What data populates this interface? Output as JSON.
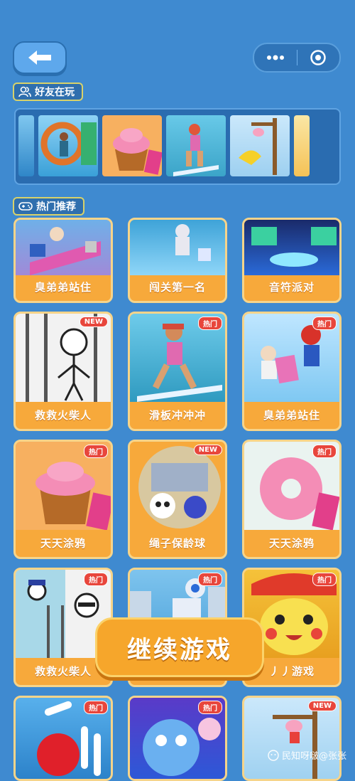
{
  "header": {
    "back_icon": "arrow-left-icon",
    "more_icon": "more-dots-icon",
    "close_icon": "target-circle-icon"
  },
  "friends_section": {
    "label": "好友在玩",
    "icon": "friends-icon"
  },
  "hot_section": {
    "label": "热门推荐",
    "icon": "gamepad-icon"
  },
  "games": [
    {
      "name": "臭弟弟站住",
      "badge": ""
    },
    {
      "name": "闯关第一名",
      "badge": ""
    },
    {
      "name": "音符派对",
      "badge": ""
    },
    {
      "name": "救救火柴人",
      "badge": "NEW"
    },
    {
      "name": "滑板冲冲冲",
      "badge": "热门"
    },
    {
      "name": "臭弟弟站住",
      "badge": "热门"
    },
    {
      "name": "天天涂鸦",
      "badge": "热门"
    },
    {
      "name": "绳子保龄球",
      "badge": "NEW"
    },
    {
      "name": "天天涂鸦",
      "badge": "热门"
    },
    {
      "name": "救救火柴人",
      "badge": "热门"
    },
    {
      "name": "",
      "badge": "热门"
    },
    {
      "name": "丿丿游戏",
      "badge": "热门"
    },
    {
      "name": "",
      "badge": "热门"
    },
    {
      "name": "",
      "badge": "热门"
    },
    {
      "name": "",
      "badge": "NEW"
    }
  ],
  "continue_button": {
    "label": "继续游戏"
  },
  "watermark": {
    "text": "民知呀啵@张张"
  },
  "colors": {
    "background": "#3f8ad0",
    "card": "#f7a93b",
    "badge": "#e8463c",
    "button": "#f6a62b"
  }
}
